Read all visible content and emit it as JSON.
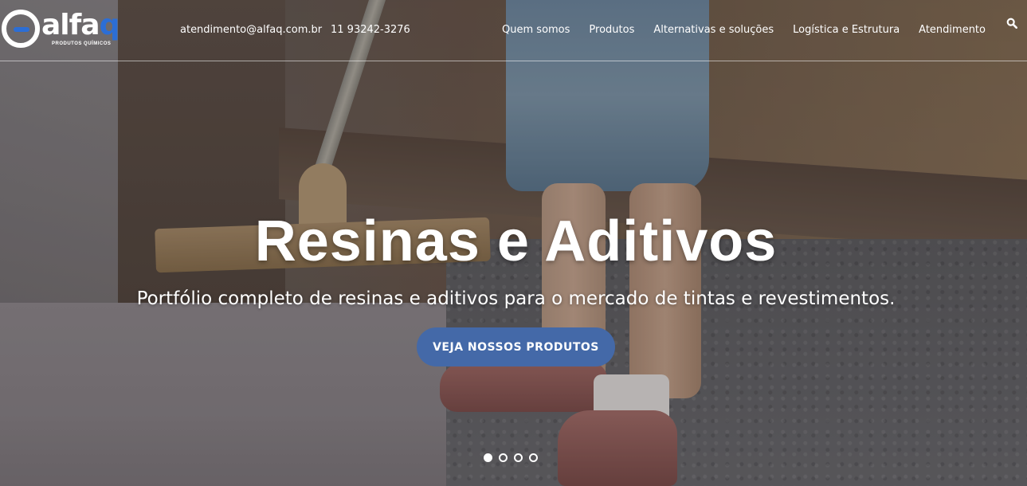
{
  "header": {
    "logo": {
      "wordmark_main": "alfa",
      "wordmark_accent": "q",
      "tagline": "PRODUTOS QUÍMICOS"
    },
    "email": "atendimento@alfaq.com.br",
    "phone": "11 93242-3276",
    "nav": [
      {
        "label": "Quem somos"
      },
      {
        "label": "Produtos"
      },
      {
        "label": "Alternativas e soluções"
      },
      {
        "label": "Logística e Estrutura"
      },
      {
        "label": "Atendimento"
      }
    ],
    "search_icon": "search-icon"
  },
  "hero": {
    "title": "Resinas e Aditivos",
    "subtitle": "Portfólio completo de resinas e aditivos para o mercado de tintas e revestimentos.",
    "cta_label": "VEJA NOSSOS PRODUTOS",
    "slides_total": 4,
    "active_slide": 1
  },
  "colors": {
    "accent": "#4469a8",
    "logo_blue": "#2c6ed5",
    "text": "#ffffff"
  }
}
